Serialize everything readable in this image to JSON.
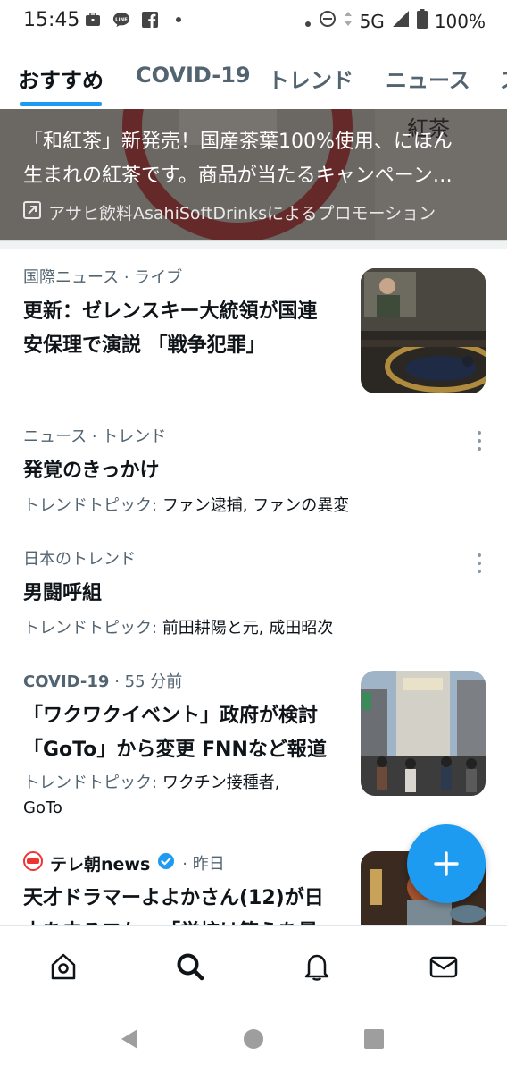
{
  "status_bar": {
    "time": "15:45",
    "left_icons": [
      "briefcase-icon",
      "line-app-icon",
      "facebook-icon",
      "dot-icon"
    ],
    "network": "5G",
    "battery": "100%"
  },
  "tabs": [
    {
      "label": "おすすめ",
      "active": true
    },
    {
      "label": "COVID-19",
      "active": false
    },
    {
      "label": "トレンド",
      "active": false
    },
    {
      "label": "ニュース",
      "active": false
    }
  ],
  "promo": {
    "line1": "「和紅茶」新発売！国産茶葉100%使用、にほん",
    "line2": "生まれの紅茶です。商品が当たるキャンペーン…",
    "byline": "アサヒ飲料AsahiSoftDrinksによるプロモーション",
    "image_text": "紅茶"
  },
  "items": [
    {
      "meta": "国際ニュース · ライブ",
      "headline_1": "更新：ゼレンスキー大統領が国連",
      "headline_2": "安保理で演説 「戦争犯罪」"
    },
    {
      "meta": "ニュース · トレンド",
      "headline": "発覚のきっかけ",
      "sub_label": "トレンドトピック:",
      "sub_topics": "ファン逮捕, ファンの異変"
    },
    {
      "meta": "日本のトレンド",
      "headline": "男闘呼組",
      "sub_label": "トレンドトピック:",
      "sub_topics": "前田耕陽と元, 成田昭次"
    },
    {
      "meta_tag": "COVID-19",
      "meta_time": "· 55 分前",
      "headline_1": "「ワクワクイベント」政府が検討",
      "headline_2": "「GoTo」から変更 FNNなど報道",
      "sub_label": "トレンドトピック:",
      "sub_topics_1": "ワクチン接種者,",
      "sub_topics_2": "GoTo"
    },
    {
      "source": "テレ朝news",
      "time": "· 昨日",
      "headline_1": "天才ドラマーよよかさん(12)が日",
      "headline_2": "本を去るワケ～「学校は答えを暴"
    }
  ],
  "colors": {
    "accent": "#1d9bf0",
    "text_primary": "#0f1419",
    "text_secondary": "#536471"
  }
}
